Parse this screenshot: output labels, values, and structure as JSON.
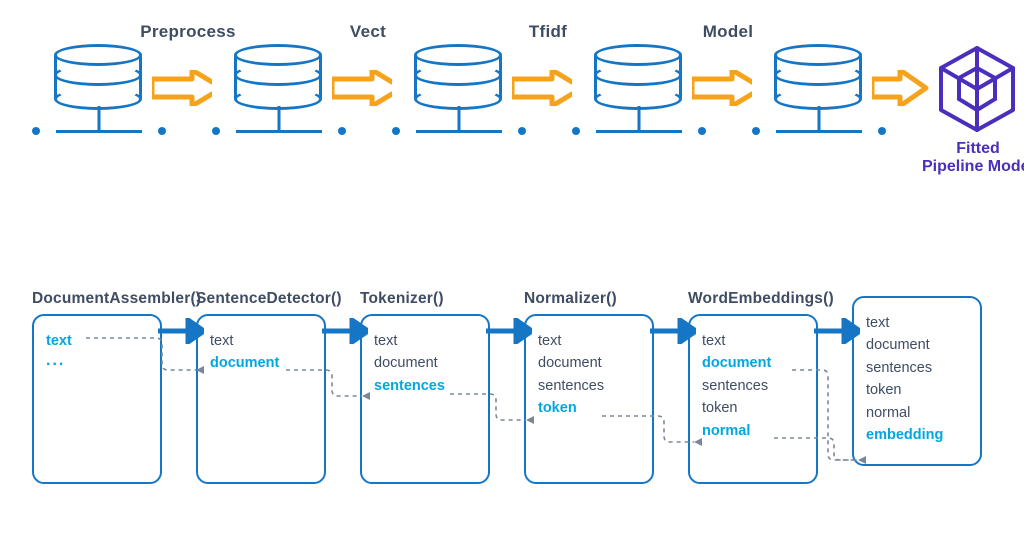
{
  "colors": {
    "blue": "#1676c6",
    "cyan": "#00a7e1",
    "orange": "#f6a21b",
    "purple": "#4b2fbc",
    "text": "#3f4d63"
  },
  "top_pipeline": {
    "stages": [
      {
        "label": ""
      },
      {
        "label": "Preprocess"
      },
      {
        "label": "Vect"
      },
      {
        "label": "Tfidf"
      },
      {
        "label": "Model"
      }
    ],
    "output": {
      "caption_line1": "Fitted",
      "caption_line2": "Pipeline Model"
    }
  },
  "bottom_pipeline": {
    "stages": [
      {
        "title": "DocumentAssembler()",
        "columns": [
          "text"
        ],
        "ellipsis": "...",
        "accent_index": 0
      },
      {
        "title": "SentenceDetector()",
        "columns": [
          "text",
          "document"
        ],
        "accent_index": 1
      },
      {
        "title": "Tokenizer()",
        "columns": [
          "text",
          "document",
          "sentences"
        ],
        "accent_index": 2
      },
      {
        "title": "Normalizer()",
        "columns": [
          "text",
          "document",
          "sentences",
          "token"
        ],
        "accent_index": 3
      },
      {
        "title": "WordEmbeddings()",
        "columns": [
          "text",
          "document",
          "sentences",
          "token",
          "normal"
        ],
        "accent_index": [
          1,
          4
        ]
      },
      {
        "title": "",
        "columns": [
          "text",
          "document",
          "sentences",
          "token",
          "normal",
          "embedding"
        ],
        "accent_index": 5
      }
    ]
  }
}
